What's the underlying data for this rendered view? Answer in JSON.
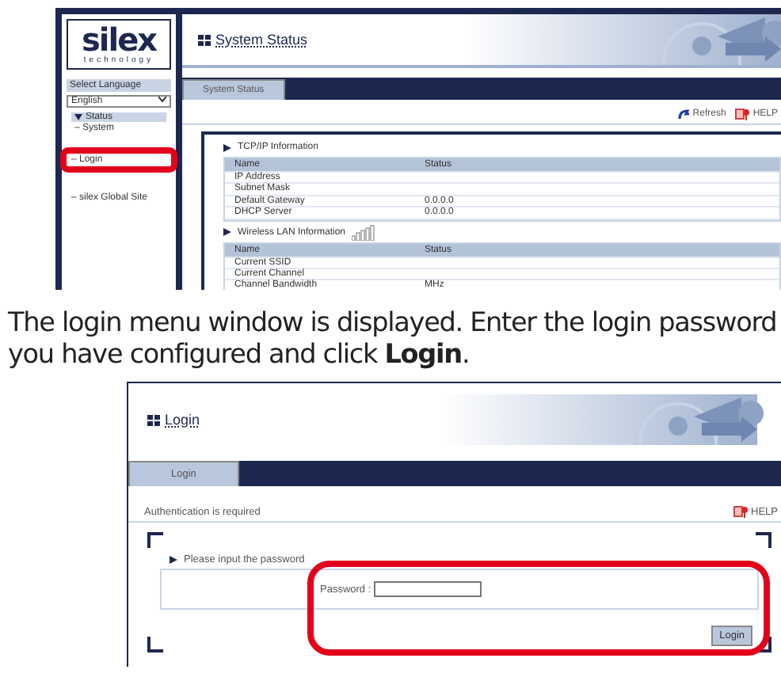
{
  "status_screen": {
    "logo": {
      "name": "silex",
      "tagline": "technology"
    },
    "language": {
      "label": "Select Language",
      "value": "English"
    },
    "sidebar": {
      "items": [
        {
          "label": "Status",
          "expanded": true,
          "highlighted": false,
          "children": [
            {
              "label": "– System",
              "highlighted": false
            }
          ]
        },
        {
          "label": "– Login",
          "highlighted": true
        },
        {
          "label": "– silex Global Site",
          "highlighted": false
        }
      ]
    },
    "title": "System Status",
    "tabs": [
      {
        "label": "System Status",
        "selected": true
      }
    ],
    "toolbar": [
      {
        "kind": "refresh",
        "label": "Refresh"
      },
      {
        "kind": "help",
        "label": "HELP"
      }
    ],
    "sections": [
      {
        "title": "TCP/IP Information",
        "signal": false,
        "columns": [
          "Name",
          "Status"
        ],
        "rows": [
          [
            "IP Address",
            ""
          ],
          [
            "Subnet Mask",
            ""
          ],
          [
            "Default Gateway",
            "0.0.0.0"
          ],
          [
            "DHCP Server",
            "0.0.0.0"
          ]
        ]
      },
      {
        "title": "Wireless LAN Information",
        "signal": true,
        "columns": [
          "Name",
          "Status"
        ],
        "rows": [
          [
            "Current SSID",
            ""
          ],
          [
            "Current Channel",
            ""
          ],
          [
            "Channel Bandwidth",
            "MHz"
          ]
        ]
      }
    ]
  },
  "caption": "The login menu window is displayed. Enter the login password you have configured and click **Login**.",
  "login_screen": {
    "title": "Login",
    "tabs": [
      {
        "label": "Login",
        "selected": true
      }
    ],
    "notice": "Authentication is required",
    "help": "HELP",
    "section": "Please input the password",
    "field": {
      "label": "Password :"
    },
    "button": "Login",
    "highlighted": true
  }
}
